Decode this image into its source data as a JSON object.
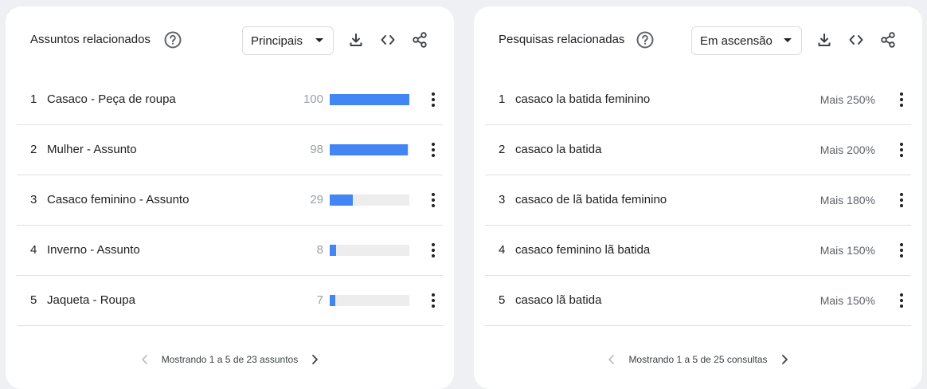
{
  "left": {
    "title": "Assuntos relacionados",
    "dropdown": "Principais",
    "rows": [
      {
        "rank": "1",
        "label": "Casaco - Peça de roupa",
        "value": "100",
        "level": 100
      },
      {
        "rank": "2",
        "label": "Mulher - Assunto",
        "value": "98",
        "level": 98
      },
      {
        "rank": "3",
        "label": "Casaco feminino - Assunto",
        "value": "29",
        "level": 29
      },
      {
        "rank": "4",
        "label": "Inverno - Assunto",
        "value": "8",
        "level": 8
      },
      {
        "rank": "5",
        "label": "Jaqueta - Roupa",
        "value": "7",
        "level": 7
      }
    ],
    "pager": "Mostrando 1 a 5 de 23 assuntos"
  },
  "right": {
    "title": "Pesquisas relacionadas",
    "dropdown": "Em ascensão",
    "rows": [
      {
        "rank": "1",
        "label": "casaco la batida feminino",
        "trend": "Mais 250%"
      },
      {
        "rank": "2",
        "label": "casaco la batida",
        "trend": "Mais 200%"
      },
      {
        "rank": "3",
        "label": "casaco de lã batida feminino",
        "trend": "Mais 180%"
      },
      {
        "rank": "4",
        "label": "casaco feminino lã batida",
        "trend": "Mais 150%"
      },
      {
        "rank": "5",
        "label": "casaco lã batida",
        "trend": "Mais 150%"
      }
    ],
    "pager": "Mostrando 1 a 5 de 25 consultas"
  },
  "colors": {
    "bar": "#4285f4",
    "track": "#ededed",
    "muted": "#9aa0a6"
  },
  "icons": [
    "help-icon",
    "download-icon",
    "embed-code-icon",
    "share-icon",
    "more-vert-icon",
    "chevron-left-icon",
    "chevron-right-icon",
    "caret-down-icon"
  ]
}
